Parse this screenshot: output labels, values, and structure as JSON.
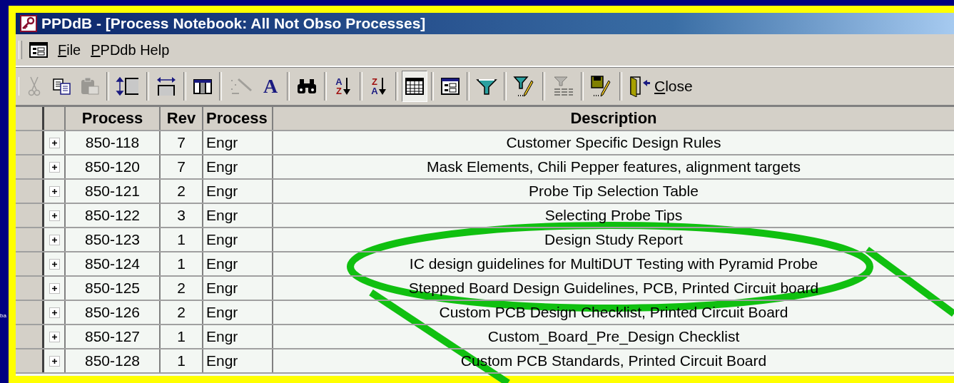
{
  "background_text": "ba",
  "window": {
    "title": "PPDdB - [Process Notebook: All Not Obso Processes]"
  },
  "menu": {
    "items": [
      {
        "label": "File"
      },
      {
        "label": "PPDdb Help"
      }
    ]
  },
  "toolbar": {
    "groups": [
      [
        {
          "disabled": true,
          "selected": false
        },
        {
          "disabled": false,
          "selected": false
        },
        {
          "disabled": true,
          "selected": false
        }
      ],
      [
        {
          "disabled": false,
          "selected": false
        }
      ],
      [
        {
          "disabled": false,
          "selected": false
        }
      ],
      [
        {
          "disabled": false,
          "selected": false
        }
      ],
      [
        {
          "disabled": true,
          "selected": false
        },
        {
          "glyph": "A",
          "disabled": false,
          "selected": false
        }
      ],
      [
        {
          "disabled": false,
          "selected": false
        }
      ],
      [
        {
          "glyph": "A",
          "glyph2": "Z",
          "disabled": false,
          "selected": false
        }
      ],
      [
        {
          "glyph": "Z",
          "glyph2": "A",
          "disabled": false,
          "selected": false
        }
      ],
      [
        {
          "disabled": false,
          "selected": true
        }
      ],
      [
        {
          "disabled": false,
          "selected": false
        }
      ],
      [
        {
          "disabled": false,
          "selected": false
        }
      ],
      [
        {
          "disabled": false,
          "selected": false
        }
      ],
      [
        {
          "disabled": true,
          "selected": false
        }
      ],
      [
        {
          "disabled": false,
          "selected": false
        }
      ],
      [
        {
          "label": "Close",
          "disabled": false,
          "selected": false
        }
      ]
    ]
  },
  "table": {
    "columns": [
      "Process",
      "Rev",
      "Process",
      "Description"
    ],
    "rows": [
      {
        "process": "850-118",
        "rev": "7",
        "type": "Engr",
        "description": "Customer Specific Design Rules"
      },
      {
        "process": "850-120",
        "rev": "7",
        "type": "Engr",
        "description": "Mask Elements, Chili Pepper features, alignment targets"
      },
      {
        "process": "850-121",
        "rev": "2",
        "type": "Engr",
        "description": "Probe Tip Selection Table"
      },
      {
        "process": "850-122",
        "rev": "3",
        "type": "Engr",
        "description": "Selecting Probe Tips"
      },
      {
        "process": "850-123",
        "rev": "1",
        "type": "Engr",
        "description": "Design Study Report"
      },
      {
        "process": "850-124",
        "rev": "1",
        "type": "Engr",
        "description": "IC design guidelines for MultiDUT Testing with Pyramid Probe"
      },
      {
        "process": "850-125",
        "rev": "2",
        "type": "Engr",
        "description": "Stepped Board Design Guidelines, PCB, Printed Circuit board"
      },
      {
        "process": "850-126",
        "rev": "2",
        "type": "Engr",
        "description": "Custom PCB Design Checklist, Printed Circuit Board"
      },
      {
        "process": "850-127",
        "rev": "1",
        "type": "Engr",
        "description": "Custom_Board_Pre_Design Checklist"
      },
      {
        "process": "850-128",
        "rev": "1",
        "type": "Engr",
        "description": "Custom PCB Standards, Printed Circuit Board"
      }
    ]
  },
  "annotations": [
    {
      "kind": "ellipse"
    },
    {
      "kind": "line"
    },
    {
      "kind": "line"
    }
  ]
}
